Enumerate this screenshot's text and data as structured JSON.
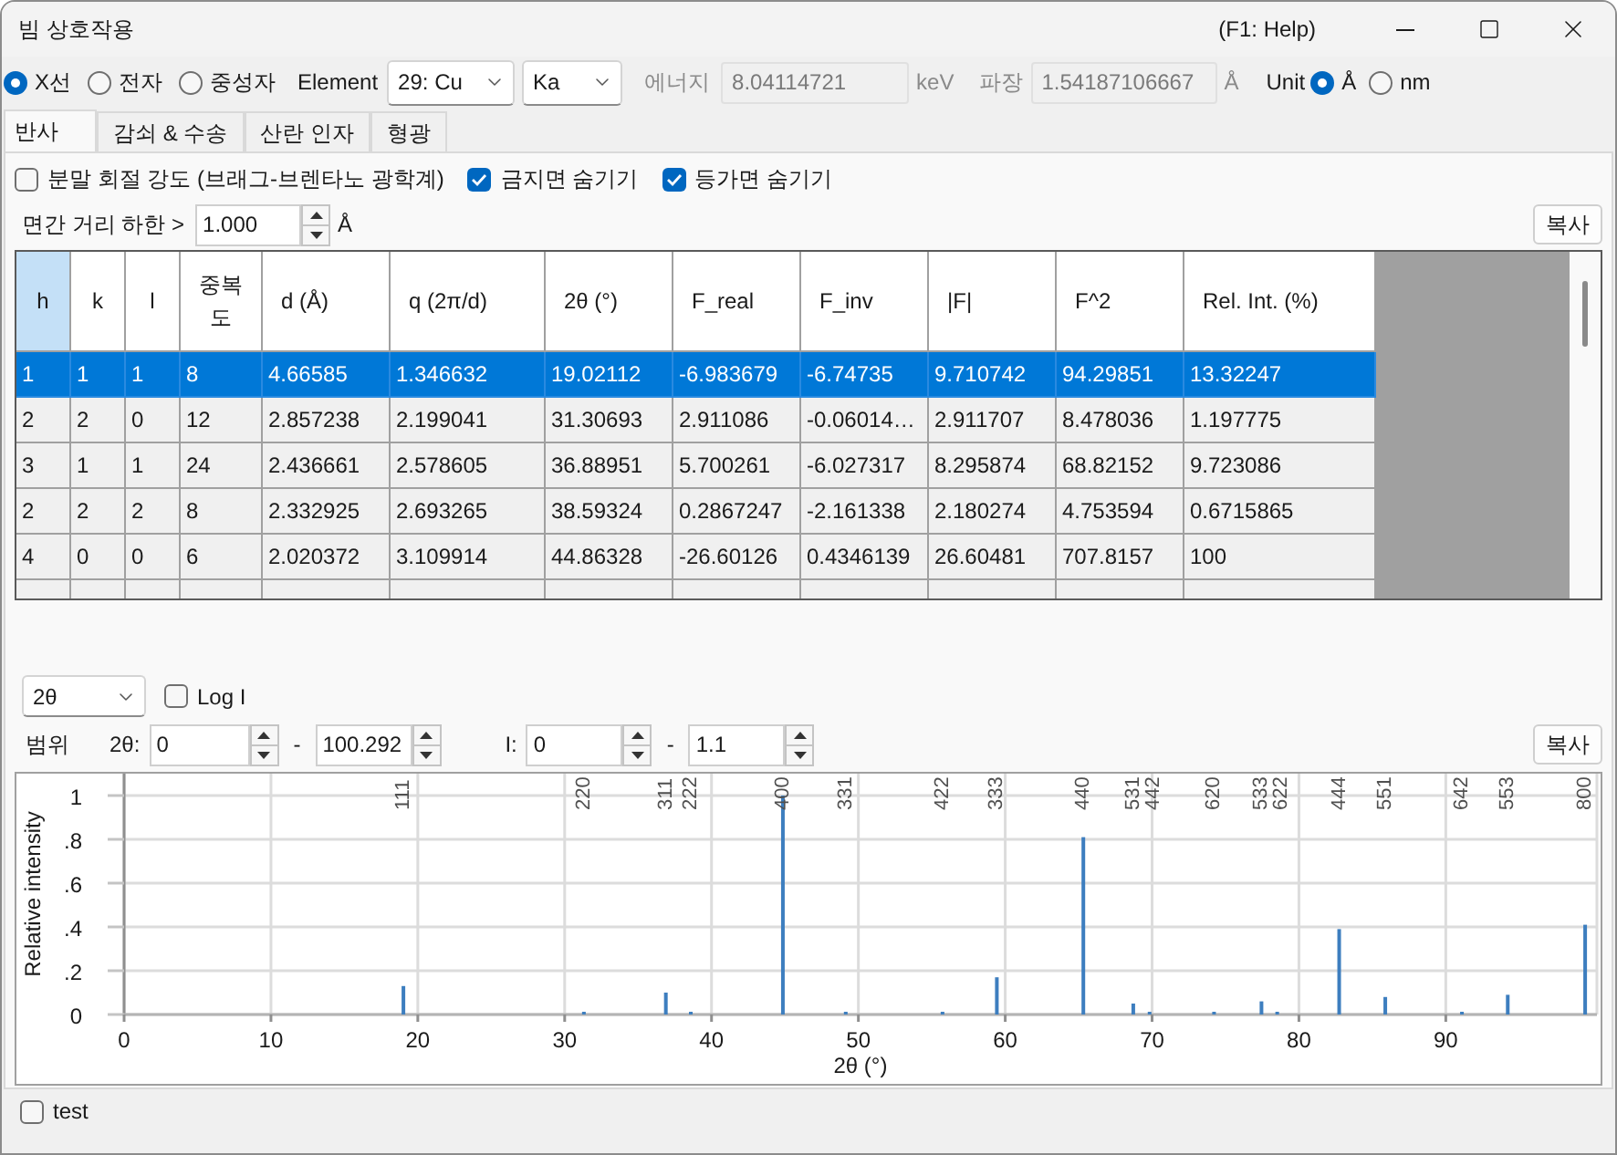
{
  "window": {
    "title": "빔 상호작용",
    "help": "(F1: Help)"
  },
  "source": {
    "radios": [
      {
        "label": "X선",
        "selected": true
      },
      {
        "label": "전자",
        "selected": false
      },
      {
        "label": "중성자",
        "selected": false
      }
    ],
    "element_label": "Element",
    "element": "29: Cu",
    "line": "Ka",
    "energy": {
      "label": "에너지",
      "value": "8.04114721",
      "unit": "keV",
      "disabled": true
    },
    "wavelength": {
      "label": "파장",
      "value": "1.54187106667",
      "unit": "Å",
      "disabled": true
    },
    "unit_label": "Unit",
    "units": [
      {
        "label": "Å",
        "selected": true
      },
      {
        "label": "nm",
        "selected": false
      }
    ]
  },
  "tabs": [
    {
      "label": "반사",
      "selected": true
    },
    {
      "label": "감쇠 & 수송",
      "selected": false
    },
    {
      "label": "산란 인자",
      "selected": false
    },
    {
      "label": "형광",
      "selected": false
    }
  ],
  "options": [
    {
      "label": "분말 회절 강도 (브래그-브렌타노 광학계)",
      "checked": false
    },
    {
      "label": "금지면 숨기기",
      "checked": true
    },
    {
      "label": "등가면 숨기기",
      "checked": true
    }
  ],
  "d_spacing_min": {
    "label": "면간 거리 하한 >",
    "value": "1.000",
    "unit": "Å"
  },
  "table_copy_button": "복사",
  "table": {
    "columns": [
      {
        "label": "h",
        "selected": true
      },
      {
        "label": "k",
        "selected": false
      },
      {
        "label": "l",
        "selected": false
      },
      {
        "label": "중복도",
        "selected": false
      },
      {
        "label": "d (Å)",
        "selected": false
      },
      {
        "label": "q (2π/d)",
        "selected": false
      },
      {
        "label": "2θ (°)",
        "selected": false
      },
      {
        "label": "F_real",
        "selected": false
      },
      {
        "label": "F_inv",
        "selected": false
      },
      {
        "label": "|F|",
        "selected": false
      },
      {
        "label": "F^2",
        "selected": false
      },
      {
        "label": "Rel. Int. (%)",
        "selected": false
      }
    ],
    "rows": [
      {
        "selected": true,
        "cells": [
          "1",
          "1",
          "1",
          "8",
          "4.66585",
          "1.346632",
          "19.02112",
          "-6.983679",
          "-6.74735",
          "9.710742",
          "94.29851",
          "13.32247"
        ]
      },
      {
        "selected": false,
        "cells": [
          "2",
          "2",
          "0",
          "12",
          "2.857238",
          "2.199041",
          "31.30693",
          "2.911086",
          "-0.06014…",
          "2.911707",
          "8.478036",
          "1.197775"
        ]
      },
      {
        "selected": false,
        "cells": [
          "3",
          "1",
          "1",
          "24",
          "2.436661",
          "2.578605",
          "36.88951",
          "5.700261",
          "-6.027317",
          "8.295874",
          "68.82152",
          "9.723086"
        ]
      },
      {
        "selected": false,
        "cells": [
          "2",
          "2",
          "2",
          "8",
          "2.332925",
          "2.693265",
          "38.59324",
          "0.2867247",
          "-2.161338",
          "2.180274",
          "4.753594",
          "0.6715865"
        ]
      },
      {
        "selected": false,
        "cells": [
          "4",
          "0",
          "0",
          "6",
          "2.020372",
          "3.109914",
          "44.86328",
          "-26.60126",
          "0.4346139",
          "26.60481",
          "707.8157",
          "100"
        ]
      }
    ]
  },
  "plot_controls": {
    "axis_select": "2θ",
    "log_scale": {
      "label": "Log I",
      "checked": false
    },
    "range_label": "범위",
    "x_range": {
      "label": "2θ:",
      "min": "0",
      "separator": "-",
      "max": "100.292"
    },
    "y_range": {
      "label": "I:",
      "min": "0",
      "separator": "-",
      "max": "1.1"
    },
    "copy_button": "복사"
  },
  "chart": {
    "chart_data": {
      "type": "bar",
      "grid": true,
      "xlabel": "2θ (°)",
      "ylabel": "Relative intensity",
      "x": [
        19.02,
        31.31,
        36.89,
        38.59,
        44.86,
        49.14,
        55.73,
        59.43,
        65.32,
        68.72,
        69.83,
        74.22,
        77.45,
        78.52,
        82.74,
        85.88,
        91.1,
        94.22,
        99.49
      ],
      "series": [
        {
          "color": "#3d7ebf",
          "values": [
            0.13,
            0.01,
            0.1,
            0.01,
            1,
            0.01,
            0.01,
            0.17,
            0.81,
            0.05,
            0.01,
            0.01,
            0.06,
            0.01,
            0.39,
            0.08,
            0.01,
            0.09,
            0.41
          ]
        }
      ],
      "xlim": [
        0,
        100.292
      ],
      "ylim": [
        0,
        1.1
      ],
      "xticks": [
        0,
        10,
        20,
        30,
        40,
        50,
        60,
        70,
        80,
        90
      ],
      "yticks": [
        0,
        {
          "value": 0.2,
          "label": ".2"
        },
        {
          "value": 0.4,
          "label": ".4"
        },
        {
          "value": 0.6,
          "label": ".6"
        },
        {
          "value": 0.8,
          "label": ".8"
        },
        1
      ],
      "annotations": [
        "111",
        "220",
        "311",
        "222",
        "400",
        "331",
        "422",
        "333",
        "440",
        "531",
        "442",
        "620",
        "533",
        "622",
        "444",
        "551",
        "642",
        "553",
        "800"
      ]
    }
  },
  "footer": {
    "test": {
      "label": "test",
      "checked": false
    }
  }
}
